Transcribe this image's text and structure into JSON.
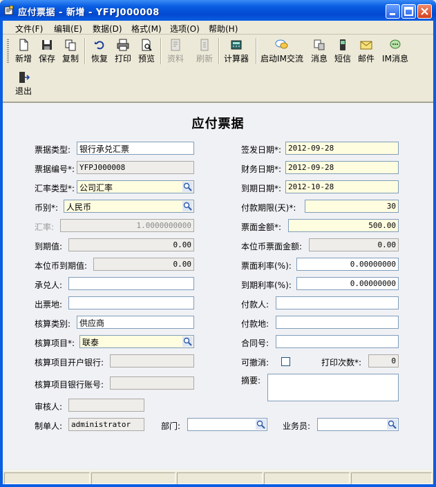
{
  "window": {
    "title": "应付票据 - 新增 - YFPJ000008"
  },
  "menu": [
    {
      "label": "文件(F)"
    },
    {
      "label": "编辑(E)"
    },
    {
      "label": "数据(D)"
    },
    {
      "label": "格式(M)"
    },
    {
      "label": "选项(O)"
    },
    {
      "label": "帮助(H)"
    }
  ],
  "toolbar": {
    "new": "新增",
    "save": "保存",
    "copy": "复制",
    "restore": "恢复",
    "print": "打印",
    "preview": "预览",
    "info": "资料",
    "refresh": "刷新",
    "calculator": "计算器",
    "start_im": "启动IM交流",
    "message": "消息",
    "sms": "短信",
    "mail": "邮件",
    "im_message": "IM消息",
    "exit": "退出"
  },
  "form": {
    "title": "应付票据",
    "bill_type": {
      "label": "票据类型:",
      "value": "银行承兑汇票"
    },
    "bill_no": {
      "label": "票据编号*:",
      "value": "YFPJ000008"
    },
    "rate_type": {
      "label": "汇率类型*:",
      "value": "公司汇率"
    },
    "currency": {
      "label": "币别*:",
      "value": "人民币"
    },
    "exchange_rate": {
      "label": "汇率:",
      "value": "1.0000000000"
    },
    "maturity_value": {
      "label": "到期值:",
      "value": "0.00"
    },
    "local_maturity_value": {
      "label": "本位币到期值:",
      "value": "0.00"
    },
    "acceptor": {
      "label": "承兑人:",
      "value": ""
    },
    "issue_place": {
      "label": "出票地:",
      "value": ""
    },
    "acct_category": {
      "label": "核算类别:",
      "value": "供应商"
    },
    "acct_item": {
      "label": "核算项目*:",
      "value": "联泰"
    },
    "acct_bank": {
      "label": "核算项目开户银行:",
      "value": ""
    },
    "acct_bank_no": {
      "label": "核算项目银行账号:",
      "value": ""
    },
    "reviewer": {
      "label": "审核人:",
      "value": ""
    },
    "maker": {
      "label": "制单人:",
      "value": "administrator"
    },
    "department": {
      "label": "部门:",
      "value": ""
    },
    "salesperson": {
      "label": "业务员:",
      "value": ""
    },
    "issue_date": {
      "label": "签发日期*:",
      "value": "2012-09-28"
    },
    "finance_date": {
      "label": "财务日期*:",
      "value": "2012-09-28"
    },
    "due_date": {
      "label": "到期日期*:",
      "value": "2012-10-28"
    },
    "payment_days": {
      "label": "付款期限(天)*:",
      "value": "30"
    },
    "face_amount": {
      "label": "票面金额*:",
      "value": "500.00"
    },
    "local_face_amount": {
      "label": "本位币票面金额:",
      "value": "0.00"
    },
    "face_rate": {
      "label": "票面利率(%):",
      "value": "0.00000000"
    },
    "due_rate": {
      "label": "到期利率(%):",
      "value": "0.00000000"
    },
    "payer": {
      "label": "付款人:",
      "value": ""
    },
    "pay_place": {
      "label": "付款地:",
      "value": ""
    },
    "contract_no": {
      "label": "合同号:",
      "value": ""
    },
    "revocable": {
      "label": "可撤消:",
      "checked": false
    },
    "print_count": {
      "label": "打印次数*:",
      "value": "0"
    },
    "summary": {
      "label": "摘要:",
      "value": ""
    }
  }
}
